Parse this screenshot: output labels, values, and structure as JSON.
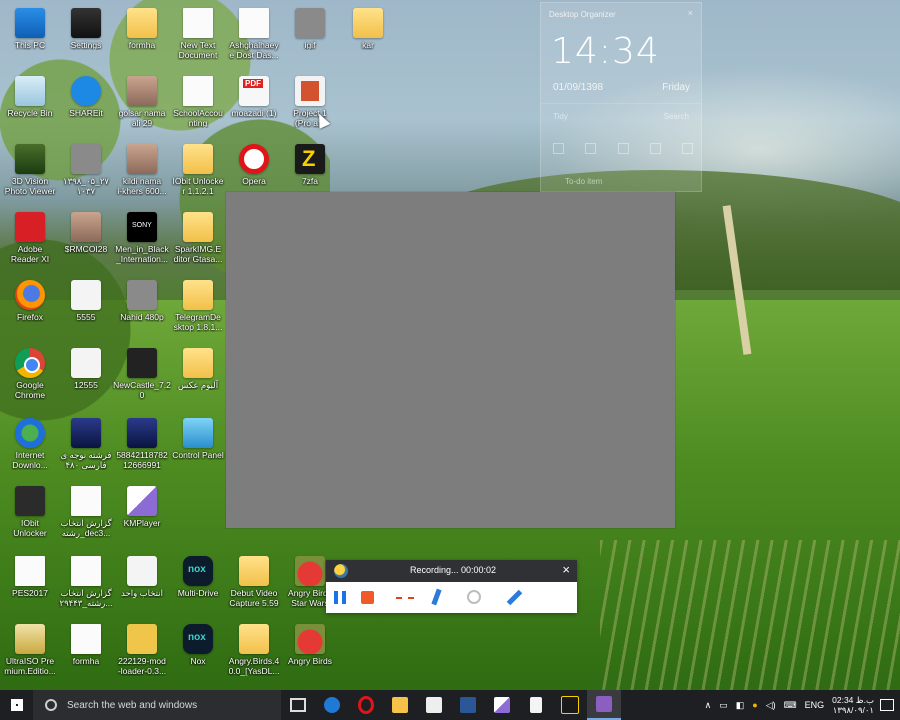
{
  "desktop_icons": [
    {
      "label": "This PC",
      "glyph": "g-pc"
    },
    {
      "label": "Settings",
      "glyph": "g-settings"
    },
    {
      "label": "formha",
      "glyph": "g-folder"
    },
    {
      "label": "New Text\nDocument",
      "glyph": "g-doc"
    },
    {
      "label": "Ashghalhaey\ne Dost Das...",
      "glyph": "g-doc"
    },
    {
      "label": "igif",
      "glyph": "g-grey"
    },
    {
      "label": "kar",
      "glyph": "g-folder"
    },
    {
      "label": "Recycle Bin",
      "glyph": "g-bin"
    },
    {
      "label": "SHAREit",
      "glyph": "g-shareit"
    },
    {
      "label": "golsar nama\nali 29",
      "glyph": "g-people"
    },
    {
      "label": "SchoolAccou\nnting",
      "glyph": "g-doc"
    },
    {
      "label": "moazadi (1)",
      "glyph": "g-pdf"
    },
    {
      "label": "Project 1\n(Pro a...",
      "glyph": "g-ppt"
    },
    {
      "label": "3D Vision\nPhoto Viewer",
      "glyph": "g-photo"
    },
    {
      "label": "۱۳۹۸_۰۵_۲۷\n۱۰۳۷",
      "glyph": "g-grey"
    },
    {
      "label": "kildi nama\ni-khers 600...",
      "glyph": "g-people"
    },
    {
      "label": "IObit Unlocke\nr 1.1.2.1",
      "glyph": "g-folder"
    },
    {
      "label": "Opera",
      "glyph": "g-opera"
    },
    {
      "label": "7zfa",
      "glyph": "g-7z"
    },
    {
      "label": "Adobe\nReader XI",
      "glyph": "g-acrobat"
    },
    {
      "label": "$RMCOI28",
      "glyph": "g-people"
    },
    {
      "label": "Men_in_Black\n_Internation...",
      "glyph": "g-sony"
    },
    {
      "label": "SparkIMG.E\nditor Gtasa...",
      "glyph": "g-folder"
    },
    {
      "label": "Firefox",
      "glyph": "g-firefox"
    },
    {
      "label": "5555",
      "glyph": "g-white"
    },
    {
      "label": "Nahid 480p",
      "glyph": "g-grey"
    },
    {
      "label": "TelegramDe\nsktop 1.8.1...",
      "glyph": "g-folder"
    },
    {
      "label": "Google\nChrome",
      "glyph": "g-chrome"
    },
    {
      "label": "12555",
      "glyph": "g-white"
    },
    {
      "label": "NewCastle_7.2\n0",
      "glyph": "g-dark"
    },
    {
      "label": "آلبوم عکس",
      "glyph": "g-folder"
    },
    {
      "label": "Internet\nDownlo...",
      "glyph": "g-idm"
    },
    {
      "label": "فرشته نوجه ی\nفارسی ۴۸۰",
      "glyph": "g-video"
    },
    {
      "label": "58842118782\n12666991",
      "glyph": "g-video"
    },
    {
      "label": "Control Panel",
      "glyph": "g-cp"
    },
    {
      "label": "IObit\nUnlocker",
      "glyph": "g-iobit"
    },
    {
      "label": "گزارش انتخاب\nرشته_dec3...",
      "glyph": "g-doc"
    },
    {
      "label": "KMPlayer",
      "glyph": "g-km"
    },
    {
      "label": "PES2017",
      "glyph": "g-doc"
    },
    {
      "label": "گزارش انتخاب\nرشته_۲۹۴۴۳...",
      "glyph": "g-doc"
    },
    {
      "label": "انتخاب واحد",
      "glyph": "g-white"
    },
    {
      "label": "Multi-Drive",
      "glyph": "g-nox"
    },
    {
      "label": "Debut Video\nCapture 5.59",
      "glyph": "g-folder"
    },
    {
      "label": "Angry Birds\nStar Wars",
      "glyph": "g-angry"
    },
    {
      "label": "UltraISO Pre\nmium.Editio...",
      "glyph": "g-iso"
    },
    {
      "label": "formha",
      "glyph": "g-doc"
    },
    {
      "label": "222129-mod\n-loader-0.3...",
      "glyph": "g-mod"
    },
    {
      "label": "Nox",
      "glyph": "g-nox"
    },
    {
      "label": "Angry.Birds.4\n0.0_[YasDL...",
      "glyph": "g-folder"
    },
    {
      "label": "Angry Birds",
      "glyph": "g-angry"
    }
  ],
  "organizer": {
    "title": "Desktop Organizer",
    "close": "×",
    "time": "14:34",
    "date": "01/09/1398",
    "day": "Friday",
    "tidy": "Tidy",
    "search": "Search",
    "todo": "To-do item"
  },
  "recorder": {
    "title": "Recording... 00:00:02",
    "close": "×"
  },
  "taskbar": {
    "search_placeholder": "Search the web and windows",
    "apps": [
      "task-view-icon",
      "edge-icon",
      "opera-icon",
      "file-explorer-icon",
      "store-icon",
      "word-icon",
      "kmplayer-icon",
      "document-icon",
      "7zip-icon",
      "winrar-icon"
    ],
    "language": "ENG",
    "clock_time": "02:34 ب.ظ",
    "clock_date": "۱۳۹۸/۰۹/۰۱"
  }
}
